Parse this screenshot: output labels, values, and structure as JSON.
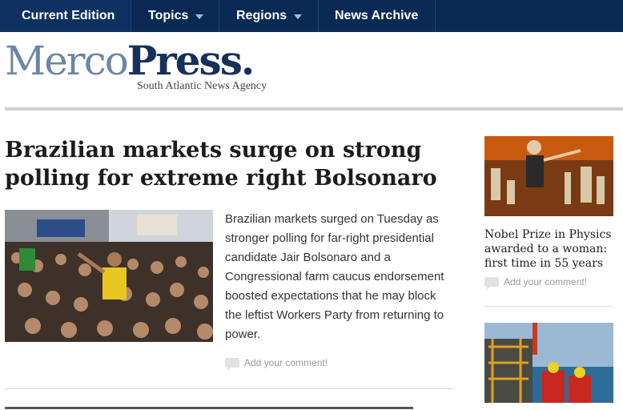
{
  "nav": {
    "items": [
      {
        "label": "Current Edition"
      },
      {
        "label": "Topics"
      },
      {
        "label": "Regions"
      },
      {
        "label": "News Archive"
      }
    ]
  },
  "logo": {
    "merco": "Merco",
    "press": "Press.",
    "tagline": "South Atlantic News Agency"
  },
  "main_story": {
    "headline": "Brazilian markets surge on strong polling for extreme right Bolsonaro",
    "body": "Brazilian markets surged on Tuesday as stronger polling for far-right presidential candidate Jair Bolsonaro and a Congressional farm caucus endorsement boosted expectations that he may block the leftist Workers Party from returning to power.",
    "comment_label": "Add your comment!"
  },
  "sidebar": {
    "story1": {
      "title": "Nobel Prize in Physics awarded to a woman: first time in 55 years",
      "comment_label": "Add your comment!"
    }
  },
  "colors": {
    "nav_bg": "#0a2a55",
    "logo_light": "#6d86a6",
    "logo_dark": "#15305b"
  }
}
